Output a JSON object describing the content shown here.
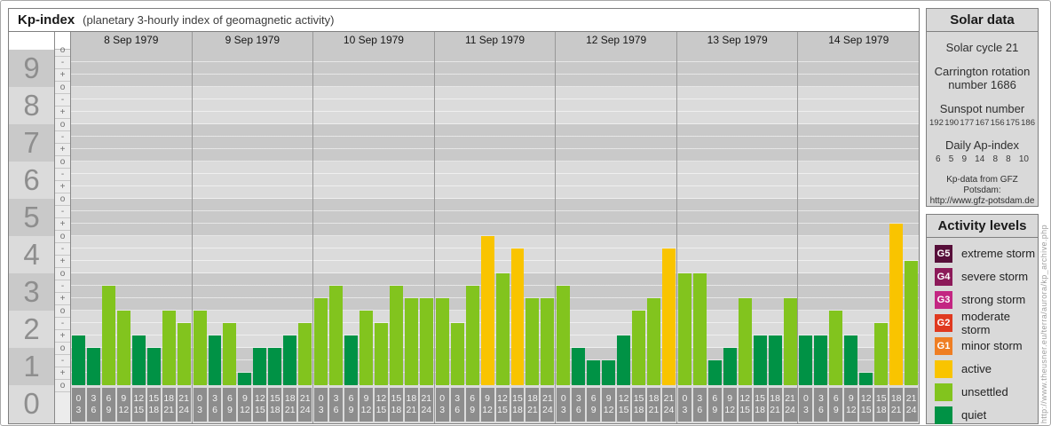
{
  "window": {
    "title": "Kp-index",
    "subtitle": "(planetary 3-hourly index of geomagnetic activity)"
  },
  "chart_data": {
    "type": "bar",
    "title": "Kp-index",
    "subtitle": "(planetary 3-hourly index of geomagnetic activity)",
    "ylabel": "Kp",
    "ylim": [
      0,
      9
    ],
    "grid": true,
    "y_major_ticks": [
      "9",
      "8",
      "7",
      "6",
      "5",
      "4",
      "3",
      "2",
      "1",
      "0"
    ],
    "y_subticks_rule": {
      "top_of_scale": [
        "o",
        "-"
      ],
      "middle": [
        "+",
        "o",
        "-"
      ],
      "bottom_of_scale": [
        "+",
        "o"
      ]
    },
    "slot_hours": [
      [
        "0",
        "3"
      ],
      [
        "3",
        "6"
      ],
      [
        "6",
        "9"
      ],
      [
        "9",
        "12"
      ],
      [
        "12",
        "15"
      ],
      [
        "15",
        "18"
      ],
      [
        "18",
        "21"
      ],
      [
        "21",
        "24"
      ]
    ],
    "level_colors": {
      "quiet": "#009245",
      "unsettled": "#82c41e",
      "active": "#f9c400"
    },
    "days": [
      {
        "date": "8 Sep 1979",
        "values": [
          1.33,
          1.0,
          2.67,
          2.0,
          1.33,
          1.0,
          2.0,
          1.67
        ],
        "kp_labels": [
          "1+",
          "1o",
          "3-",
          "2o",
          "1+",
          "1o",
          "2o",
          "2-"
        ],
        "levels": [
          "quiet",
          "quiet",
          "unsettled",
          "unsettled",
          "quiet",
          "quiet",
          "unsettled",
          "unsettled"
        ]
      },
      {
        "date": "9 Sep 1979",
        "values": [
          2.0,
          1.33,
          1.67,
          0.33,
          1.0,
          1.0,
          1.33,
          1.67
        ],
        "kp_labels": [
          "2o",
          "1+",
          "2-",
          "0+",
          "1o",
          "1o",
          "1+",
          "2-"
        ],
        "levels": [
          "unsettled",
          "quiet",
          "unsettled",
          "quiet",
          "quiet",
          "quiet",
          "quiet",
          "unsettled"
        ]
      },
      {
        "date": "10 Sep 1979",
        "values": [
          2.33,
          2.67,
          1.33,
          2.0,
          1.67,
          2.67,
          2.33,
          2.33
        ],
        "kp_labels": [
          "2+",
          "3-",
          "1+",
          "2o",
          "2-",
          "3-",
          "2+",
          "2+"
        ],
        "levels": [
          "unsettled",
          "unsettled",
          "quiet",
          "unsettled",
          "unsettled",
          "unsettled",
          "unsettled",
          "unsettled"
        ]
      },
      {
        "date": "11 Sep 1979",
        "values": [
          2.33,
          1.67,
          2.67,
          4.0,
          3.0,
          3.67,
          2.33,
          2.33
        ],
        "kp_labels": [
          "2+",
          "2-",
          "3-",
          "4o",
          "3o",
          "4-",
          "2+",
          "2+"
        ],
        "levels": [
          "unsettled",
          "unsettled",
          "unsettled",
          "active",
          "unsettled",
          "active",
          "unsettled",
          "unsettled"
        ]
      },
      {
        "date": "12 Sep 1979",
        "values": [
          2.67,
          1.0,
          0.67,
          0.67,
          1.33,
          2.0,
          2.33,
          3.67
        ],
        "kp_labels": [
          "3-",
          "1o",
          "1-",
          "1-",
          "1+",
          "2o",
          "2+",
          "4-"
        ],
        "levels": [
          "unsettled",
          "quiet",
          "quiet",
          "quiet",
          "quiet",
          "unsettled",
          "unsettled",
          "active"
        ]
      },
      {
        "date": "13 Sep 1979",
        "values": [
          3.0,
          3.0,
          0.67,
          1.0,
          2.33,
          1.33,
          1.33,
          2.33
        ],
        "kp_labels": [
          "3o",
          "3o",
          "1-",
          "1o",
          "2+",
          "1+",
          "1+",
          "2+"
        ],
        "levels": [
          "unsettled",
          "unsettled",
          "quiet",
          "quiet",
          "unsettled",
          "quiet",
          "quiet",
          "unsettled"
        ]
      },
      {
        "date": "14 Sep 1979",
        "values": [
          1.33,
          1.33,
          2.0,
          1.33,
          0.33,
          1.67,
          4.33,
          3.33
        ],
        "kp_labels": [
          "1+",
          "1+",
          "2o",
          "1+",
          "0+",
          "2-",
          "4+",
          "3+"
        ],
        "levels": [
          "quiet",
          "quiet",
          "unsettled",
          "quiet",
          "quiet",
          "unsettled",
          "active",
          "unsettled"
        ]
      }
    ]
  },
  "solar_panel": {
    "title": "Solar data",
    "solar_cycle": "Solar cycle 21",
    "carrington_line1": "Carrington rotation",
    "carrington_line2": "number 1686",
    "sunspot_label": "Sunspot number",
    "sunspot_values": [
      "192",
      "190",
      "177",
      "167",
      "156",
      "175",
      "186"
    ],
    "ap_label": "Daily Ap-index",
    "ap_values": [
      "6",
      "5",
      "9",
      "14",
      "8",
      "8",
      "10"
    ],
    "source_line1": "Kp-data from GFZ Potsdam:",
    "source_line2": "http://www.gfz-potsdam.de"
  },
  "activity_panel": {
    "title": "Activity levels",
    "items": [
      {
        "code": "G5",
        "label": "extreme storm",
        "color": "#570f3a"
      },
      {
        "code": "G4",
        "label": "severe storm",
        "color": "#8c1a59"
      },
      {
        "code": "G3",
        "label": "strong storm",
        "color": "#c32682"
      },
      {
        "code": "G2",
        "label": "moderate storm",
        "color": "#e0391f"
      },
      {
        "code": "G1",
        "label": "minor storm",
        "color": "#ef7e23"
      },
      {
        "code": "",
        "label": "active",
        "color": "#f9c400"
      },
      {
        "code": "",
        "label": "unsettled",
        "color": "#82c41e"
      },
      {
        "code": "",
        "label": "quiet",
        "color": "#009245"
      }
    ]
  },
  "watermark": "http://www.theusner.eu/terra/aurora/kp_archive.php"
}
